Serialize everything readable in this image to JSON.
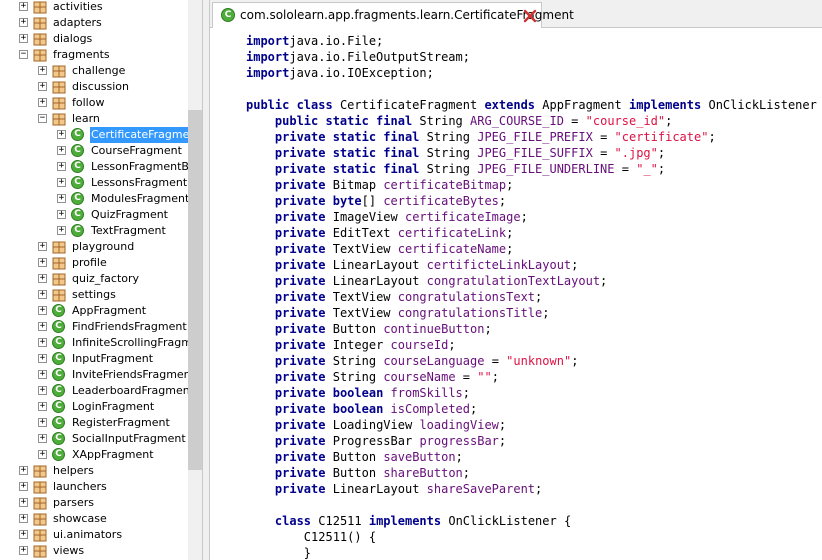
{
  "tree": {
    "items": [
      {
        "label": "activities",
        "kind": "package",
        "depth": 0,
        "expander": "+"
      },
      {
        "label": "adapters",
        "kind": "package",
        "depth": 0,
        "expander": "+"
      },
      {
        "label": "dialogs",
        "kind": "package",
        "depth": 0,
        "expander": "+"
      },
      {
        "label": "fragments",
        "kind": "package",
        "depth": 0,
        "expander": "−"
      },
      {
        "label": "challenge",
        "kind": "package",
        "depth": 1,
        "expander": "+"
      },
      {
        "label": "discussion",
        "kind": "package",
        "depth": 1,
        "expander": "+"
      },
      {
        "label": "follow",
        "kind": "package",
        "depth": 1,
        "expander": "+"
      },
      {
        "label": "learn",
        "kind": "package",
        "depth": 1,
        "expander": "−"
      },
      {
        "label": "CertificateFragment",
        "kind": "class",
        "depth": 2,
        "expander": "+",
        "selected": true
      },
      {
        "label": "CourseFragment",
        "kind": "class",
        "depth": 2,
        "expander": "+"
      },
      {
        "label": "LessonFragmentBase",
        "kind": "class",
        "depth": 2,
        "expander": "+"
      },
      {
        "label": "LessonsFragment",
        "kind": "class",
        "depth": 2,
        "expander": "+"
      },
      {
        "label": "ModulesFragmentBase",
        "kind": "class",
        "depth": 2,
        "expander": "+"
      },
      {
        "label": "QuizFragment",
        "kind": "class",
        "depth": 2,
        "expander": "+"
      },
      {
        "label": "TextFragment",
        "kind": "class",
        "depth": 2,
        "expander": "+"
      },
      {
        "label": "playground",
        "kind": "package",
        "depth": 1,
        "expander": "+"
      },
      {
        "label": "profile",
        "kind": "package",
        "depth": 1,
        "expander": "+"
      },
      {
        "label": "quiz_factory",
        "kind": "package",
        "depth": 1,
        "expander": "+"
      },
      {
        "label": "settings",
        "kind": "package",
        "depth": 1,
        "expander": "+"
      },
      {
        "label": "AppFragment",
        "kind": "class",
        "depth": 1,
        "expander": "+"
      },
      {
        "label": "FindFriendsFragment",
        "kind": "class",
        "depth": 1,
        "expander": "+"
      },
      {
        "label": "InfiniteScrollingFragment",
        "kind": "class",
        "depth": 1,
        "expander": "+"
      },
      {
        "label": "InputFragment",
        "kind": "class",
        "depth": 1,
        "expander": "+"
      },
      {
        "label": "InviteFriendsFragment",
        "kind": "class",
        "depth": 1,
        "expander": "+"
      },
      {
        "label": "LeaderboardFragment",
        "kind": "class",
        "depth": 1,
        "expander": "+"
      },
      {
        "label": "LoginFragment",
        "kind": "class",
        "depth": 1,
        "expander": "+"
      },
      {
        "label": "RegisterFragment",
        "kind": "class",
        "depth": 1,
        "expander": "+"
      },
      {
        "label": "SocialInputFragment",
        "kind": "class",
        "depth": 1,
        "expander": "+"
      },
      {
        "label": "XAppFragment",
        "kind": "class",
        "depth": 1,
        "expander": "+"
      },
      {
        "label": "helpers",
        "kind": "package",
        "depth": 0,
        "expander": "+"
      },
      {
        "label": "launchers",
        "kind": "package",
        "depth": 0,
        "expander": "+"
      },
      {
        "label": "parsers",
        "kind": "package",
        "depth": 0,
        "expander": "+"
      },
      {
        "label": "showcase",
        "kind": "package",
        "depth": 0,
        "expander": "+"
      },
      {
        "label": "ui.animators",
        "kind": "package",
        "depth": 0,
        "expander": "+"
      },
      {
        "label": "views",
        "kind": "package",
        "depth": 0,
        "expander": "+"
      }
    ]
  },
  "editor": {
    "tab": {
      "title": "com.sololearn.app.fragments.learn.CertificateFragment",
      "icon": "class-icon",
      "close_icon": "close-icon"
    },
    "colors": {
      "keyword": "#00008b",
      "field": "#660e7a",
      "string": "#dd1144",
      "close": "#cc0000",
      "selection": "#3399ff"
    },
    "code_lines": [
      [
        [
          "kw",
          "import"
        ],
        [
          "",
          ""
        ],
        [
          "",
          "java.io.File;"
        ]
      ],
      [
        [
          "kw",
          "import"
        ],
        [
          "",
          ""
        ],
        [
          "",
          "java.io.FileOutputStream;"
        ]
      ],
      [
        [
          "kw",
          "import"
        ],
        [
          "",
          ""
        ],
        [
          "",
          "java.io.IOException;"
        ]
      ],
      [],
      [
        [
          "kw",
          "public class"
        ],
        [
          "",
          "CertificateFragment"
        ],
        [
          "kw",
          "extends"
        ],
        [
          "",
          "AppFragment"
        ],
        [
          "kw",
          "implements"
        ],
        [
          "",
          "OnClickListener {"
        ]
      ],
      [
        [
          "ind",
          "    "
        ],
        [
          "kw",
          "public static final"
        ],
        [
          "",
          "String"
        ],
        [
          "fd",
          "ARG_COURSE_ID"
        ],
        [
          "",
          "="
        ],
        [
          "st",
          "\"course_id\""
        ],
        [
          "",
          ";"
        ]
      ],
      [
        [
          "ind",
          "    "
        ],
        [
          "kw",
          "private static final"
        ],
        [
          "",
          "String"
        ],
        [
          "fd",
          "JPEG_FILE_PREFIX"
        ],
        [
          "",
          "="
        ],
        [
          "st",
          "\"certificate\""
        ],
        [
          "",
          ";"
        ]
      ],
      [
        [
          "ind",
          "    "
        ],
        [
          "kw",
          "private static final"
        ],
        [
          "",
          "String"
        ],
        [
          "fd",
          "JPEG_FILE_SUFFIX"
        ],
        [
          "",
          "="
        ],
        [
          "st",
          "\".jpg\""
        ],
        [
          "",
          ";"
        ]
      ],
      [
        [
          "ind",
          "    "
        ],
        [
          "kw",
          "private static final"
        ],
        [
          "",
          "String"
        ],
        [
          "fd",
          "JPEG_FILE_UNDERLINE"
        ],
        [
          "",
          "="
        ],
        [
          "st",
          "\"_\""
        ],
        [
          "",
          ";"
        ]
      ],
      [
        [
          "ind",
          "    "
        ],
        [
          "kw",
          "private"
        ],
        [
          "",
          "Bitmap"
        ],
        [
          "fd",
          "certificateBitmap"
        ],
        [
          "",
          ";"
        ]
      ],
      [
        [
          "ind",
          "    "
        ],
        [
          "kw",
          "private"
        ],
        [
          "kw",
          "byte"
        ],
        [
          "",
          "[]"
        ],
        [
          "fd",
          "certificateBytes"
        ],
        [
          "",
          ";"
        ]
      ],
      [
        [
          "ind",
          "    "
        ],
        [
          "kw",
          "private"
        ],
        [
          "",
          "ImageView"
        ],
        [
          "fd",
          "certificateImage"
        ],
        [
          "",
          ";"
        ]
      ],
      [
        [
          "ind",
          "    "
        ],
        [
          "kw",
          "private"
        ],
        [
          "",
          "EditText"
        ],
        [
          "fd",
          "certificateLink"
        ],
        [
          "",
          ";"
        ]
      ],
      [
        [
          "ind",
          "    "
        ],
        [
          "kw",
          "private"
        ],
        [
          "",
          "TextView"
        ],
        [
          "fd",
          "certificateName"
        ],
        [
          "",
          ";"
        ]
      ],
      [
        [
          "ind",
          "    "
        ],
        [
          "kw",
          "private"
        ],
        [
          "",
          "LinearLayout"
        ],
        [
          "fd",
          "certificteLinkLayout"
        ],
        [
          "",
          ";"
        ]
      ],
      [
        [
          "ind",
          "    "
        ],
        [
          "kw",
          "private"
        ],
        [
          "",
          "LinearLayout"
        ],
        [
          "fd",
          "congratulationTextLayout"
        ],
        [
          "",
          ";"
        ]
      ],
      [
        [
          "ind",
          "    "
        ],
        [
          "kw",
          "private"
        ],
        [
          "",
          "TextView"
        ],
        [
          "fd",
          "congratulationsText"
        ],
        [
          "",
          ";"
        ]
      ],
      [
        [
          "ind",
          "    "
        ],
        [
          "kw",
          "private"
        ],
        [
          "",
          "TextView"
        ],
        [
          "fd",
          "congratulationsTitle"
        ],
        [
          "",
          ";"
        ]
      ],
      [
        [
          "ind",
          "    "
        ],
        [
          "kw",
          "private"
        ],
        [
          "",
          "Button"
        ],
        [
          "fd",
          "continueButton"
        ],
        [
          "",
          ";"
        ]
      ],
      [
        [
          "ind",
          "    "
        ],
        [
          "kw",
          "private"
        ],
        [
          "",
          "Integer"
        ],
        [
          "fd",
          "courseId"
        ],
        [
          "",
          ";"
        ]
      ],
      [
        [
          "ind",
          "    "
        ],
        [
          "kw",
          "private"
        ],
        [
          "",
          "String"
        ],
        [
          "fd",
          "courseLanguage"
        ],
        [
          "",
          "="
        ],
        [
          "st",
          "\"unknown\""
        ],
        [
          "",
          ";"
        ]
      ],
      [
        [
          "ind",
          "    "
        ],
        [
          "kw",
          "private"
        ],
        [
          "",
          "String"
        ],
        [
          "fd",
          "courseName"
        ],
        [
          "",
          "="
        ],
        [
          "st",
          "\"\""
        ],
        [
          "",
          ";"
        ]
      ],
      [
        [
          "ind",
          "    "
        ],
        [
          "kw",
          "private"
        ],
        [
          "kw",
          "boolean"
        ],
        [
          "fd",
          "fromSkills"
        ],
        [
          "",
          ";"
        ]
      ],
      [
        [
          "ind",
          "    "
        ],
        [
          "kw",
          "private"
        ],
        [
          "kw",
          "boolean"
        ],
        [
          "fd",
          "isCompleted"
        ],
        [
          "",
          ";"
        ]
      ],
      [
        [
          "ind",
          "    "
        ],
        [
          "kw",
          "private"
        ],
        [
          "",
          "LoadingView"
        ],
        [
          "fd",
          "loadingView"
        ],
        [
          "",
          ";"
        ]
      ],
      [
        [
          "ind",
          "    "
        ],
        [
          "kw",
          "private"
        ],
        [
          "",
          "ProgressBar"
        ],
        [
          "fd",
          "progressBar"
        ],
        [
          "",
          ";"
        ]
      ],
      [
        [
          "ind",
          "    "
        ],
        [
          "kw",
          "private"
        ],
        [
          "",
          "Button"
        ],
        [
          "fd",
          "saveButton"
        ],
        [
          "",
          ";"
        ]
      ],
      [
        [
          "ind",
          "    "
        ],
        [
          "kw",
          "private"
        ],
        [
          "",
          "Button"
        ],
        [
          "fd",
          "shareButton"
        ],
        [
          "",
          ";"
        ]
      ],
      [
        [
          "ind",
          "    "
        ],
        [
          "kw",
          "private"
        ],
        [
          "",
          "LinearLayout"
        ],
        [
          "fd",
          "shareSaveParent"
        ],
        [
          "",
          ";"
        ]
      ],
      [],
      [
        [
          "ind",
          "    "
        ],
        [
          "kw",
          "class"
        ],
        [
          "",
          "C12511"
        ],
        [
          "kw",
          "implements"
        ],
        [
          "",
          "OnClickListener {"
        ]
      ],
      [
        [
          "ind",
          "        "
        ],
        [
          "",
          "C12511() {"
        ]
      ],
      [
        [
          "ind",
          "        "
        ],
        [
          "",
          "}"
        ]
      ]
    ]
  }
}
